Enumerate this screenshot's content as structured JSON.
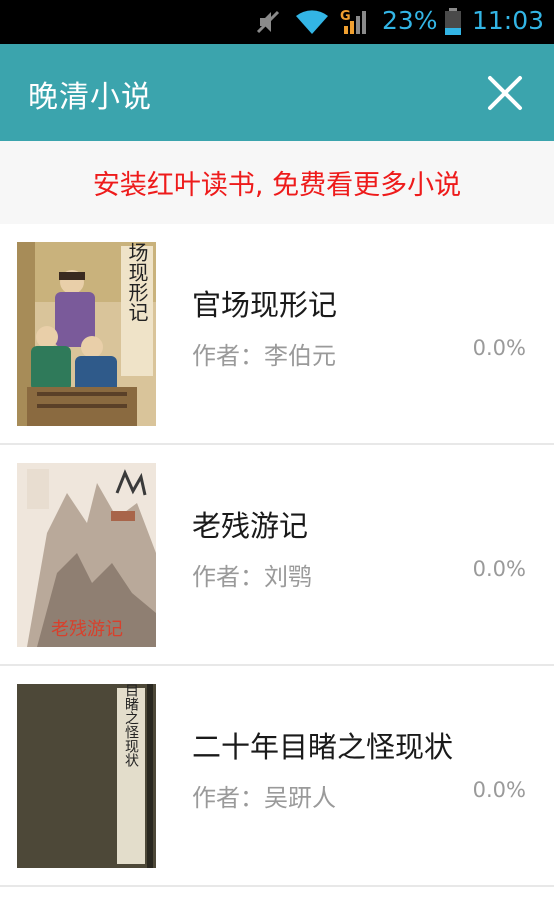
{
  "status_bar": {
    "battery_pct": "23%",
    "time": "11:03",
    "signal_type": "G",
    "accent_color": "#33b5e5"
  },
  "app_bar": {
    "title": "晚清小说",
    "close_icon": "close-icon",
    "bg_color": "#3ba4ad"
  },
  "promo": {
    "text": "安装红叶读书, 免费看更多小说",
    "color": "#ee1b1b"
  },
  "books": [
    {
      "title": "官场现形记",
      "author": "作者：李伯元",
      "progress": "0.0%",
      "cover_text": "官场现形记"
    },
    {
      "title": "老残游记",
      "author": "作者：刘鹗",
      "progress": "0.0%",
      "cover_text": "老残游记"
    },
    {
      "title": "二十年目睹之怪现状",
      "author": "作者：吴趼人",
      "progress": "0.0%",
      "cover_text": "二十年目睹之怪现状"
    }
  ]
}
